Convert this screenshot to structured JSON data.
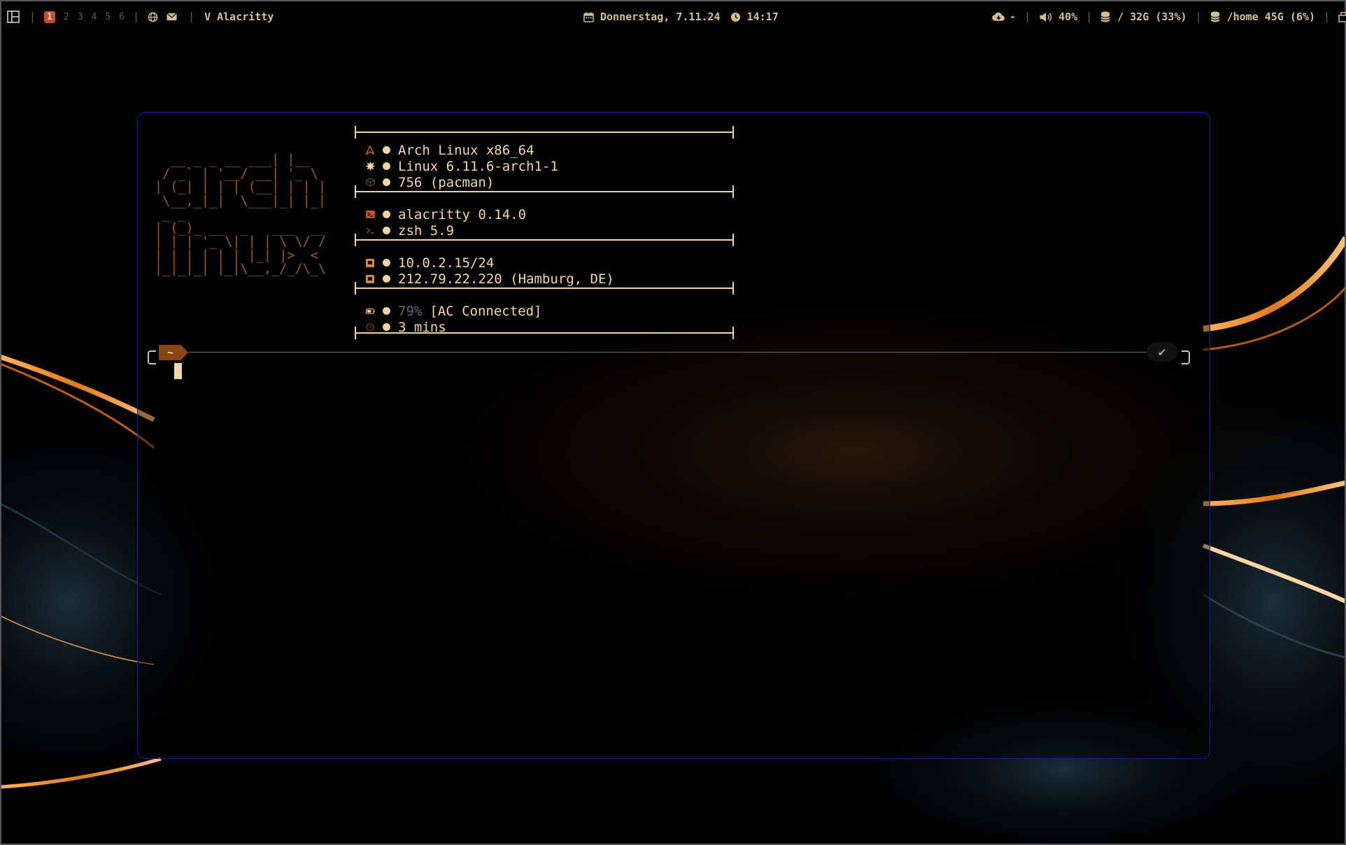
{
  "bar": {
    "layout_icon": "window-layout-icon",
    "workspaces": [
      "1",
      "2",
      "3",
      "4",
      "5",
      "6"
    ],
    "active_workspace": "1",
    "window_title": "V Alacritty",
    "date": "Donnerstag, 7.11.24",
    "time": "14:17",
    "cloud": "-",
    "volume": "40%",
    "disk_root": "/ 32G (33%)",
    "disk_home": "/home 45G (6%)"
  },
  "terminal": {
    "ascii_logo": "  __ _ _ __ ___| |__\n / _` | '__/ __| '_ \\\n| (_| | | | (__| | | |\n \\__,_|_|  \\___|_| |_|\n _ _\n| (_)_ __  _   ___  __\n| | | '_ \\| | | \\ \\/ /\n| | | | | | |_| |>  <\n|_|_|_| |_|\\__,_/_/\\_\\",
    "fetch": {
      "os": "Arch Linux x86_64",
      "kernel": "Linux 6.11.6-arch1-1",
      "packages": "756 (pacman)",
      "terminal": "alacritty 0.14.0",
      "shell": "zsh 5.9",
      "local_ip": "10.0.2.15/24",
      "public_ip": "212.79.22.220 (Hamburg, DE)",
      "battery_percent": "79%",
      "battery_status": "[AC Connected]",
      "uptime": "3 mins"
    },
    "prompt": {
      "dir": "~",
      "status": "✔"
    }
  },
  "colors": {
    "accent": "#f0d2a3",
    "logo": "#9a5a2a",
    "window_border": "#1c1aa8",
    "workspace_active": "#c0502f"
  }
}
